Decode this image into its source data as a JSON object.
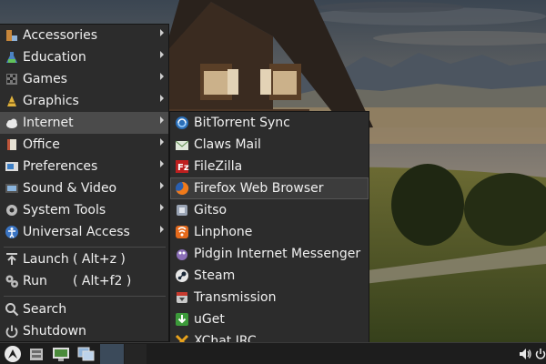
{
  "main_menu": {
    "items": [
      {
        "label": "Accessories",
        "icon": "accessories-icon"
      },
      {
        "label": "Education",
        "icon": "education-icon"
      },
      {
        "label": "Games",
        "icon": "games-icon"
      },
      {
        "label": "Graphics",
        "icon": "graphics-icon"
      },
      {
        "label": "Internet",
        "icon": "internet-icon"
      },
      {
        "label": "Office",
        "icon": "office-icon"
      },
      {
        "label": "Preferences",
        "icon": "preferences-icon"
      },
      {
        "label": "Sound & Video",
        "icon": "sound-video-icon"
      },
      {
        "label": "System Tools",
        "icon": "system-tools-icon"
      },
      {
        "label": "Universal Access",
        "icon": "universal-access-icon"
      }
    ],
    "launch": {
      "label": "Launch",
      "shortcut": "( Alt+z )"
    },
    "run": {
      "label": "Run",
      "shortcut": "( Alt+f2 )"
    },
    "search": {
      "label": "Search"
    },
    "shutdown": {
      "label": "Shutdown"
    }
  },
  "internet_submenu": {
    "items": [
      {
        "label": "BitTorrent Sync",
        "icon": "bittorrent-sync-icon"
      },
      {
        "label": "Claws Mail",
        "icon": "claws-mail-icon"
      },
      {
        "label": "FileZilla",
        "icon": "filezilla-icon"
      },
      {
        "label": "Firefox Web Browser",
        "icon": "firefox-icon"
      },
      {
        "label": "Gitso",
        "icon": "gitso-icon"
      },
      {
        "label": "Linphone",
        "icon": "linphone-icon"
      },
      {
        "label": "Pidgin Internet Messenger",
        "icon": "pidgin-icon"
      },
      {
        "label": "Steam",
        "icon": "steam-icon"
      },
      {
        "label": "Transmission",
        "icon": "transmission-icon"
      },
      {
        "label": "uGet",
        "icon": "uget-icon"
      },
      {
        "label": "XChat IRC",
        "icon": "xchat-icon"
      }
    ],
    "highlighted": "Firefox Web Browser"
  },
  "taskbar": {
    "icons": [
      "start-menu-icon",
      "file-manager-icon",
      "system-monitor-icon",
      "show-desktop-icon",
      "workspace-switcher"
    ],
    "tray": [
      "volume-icon",
      "power-icon"
    ]
  }
}
